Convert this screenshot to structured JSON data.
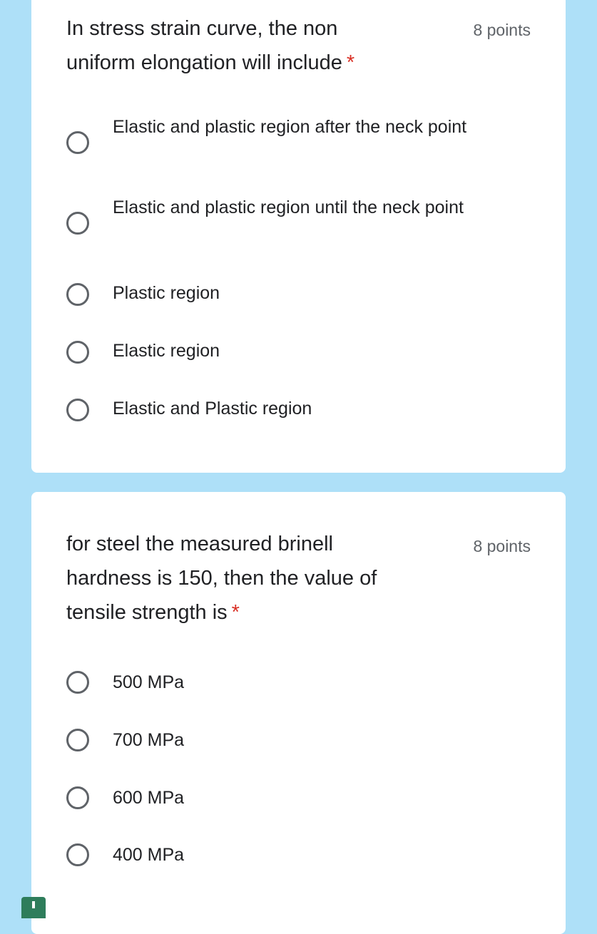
{
  "questions": [
    {
      "title": "In stress strain curve, the non uniform elongation will include",
      "required_mark": "*",
      "points": "8 points",
      "options": [
        "Elastic and plastic region after the neck point",
        "Elastic and plastic region until the neck point",
        "Plastic region",
        "Elastic region",
        "Elastic and Plastic region"
      ]
    },
    {
      "title": "for steel the measured brinell hardness is 150, then the value of tensile strength is",
      "required_mark": "*",
      "points": "8 points",
      "options": [
        "500 MPa",
        "700 MPa",
        "600 MPa",
        "400 MPa"
      ]
    }
  ]
}
